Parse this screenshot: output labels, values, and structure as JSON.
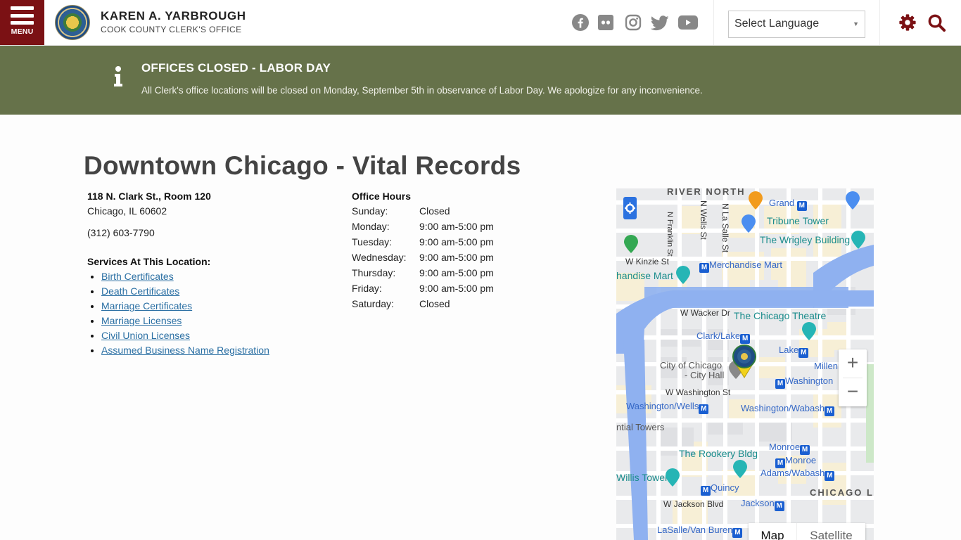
{
  "header": {
    "menu_label": "MENU",
    "brand_name": "KAREN A. YARBROUGH",
    "brand_subtitle": "COOK COUNTY CLERK'S OFFICE",
    "social_icons": [
      "facebook-icon",
      "flickr-icon",
      "instagram-icon",
      "twitter-icon",
      "youtube-icon"
    ],
    "language_select": {
      "selected": "Select Language"
    },
    "colors": {
      "brand": "#7b1114",
      "social": "#888888"
    }
  },
  "alert": {
    "title": "OFFICES CLOSED - LABOR DAY",
    "body": "All Clerk's office locations will be closed on Monday, September 5th in observance of Labor Day. We apologize for any inconvenience.",
    "color": "#66724a"
  },
  "main": {
    "title": "Downtown Chicago - Vital Records",
    "address_line1": "118 N. Clark St., Room 120",
    "address_line2": "Chicago, IL 60602",
    "phone": "(312) 603-7790",
    "services_title": "Services At This Location:",
    "services": [
      "Birth Certificates",
      "Death Certificates",
      "Marriage Certificates",
      "Marriage Licenses",
      "Civil Union Licenses",
      "Assumed Business Name Registration"
    ],
    "hours_title": "Office Hours",
    "hours": [
      {
        "day": "Sunday:",
        "time": "Closed"
      },
      {
        "day": "Monday:",
        "time": "9:00 am-5:00 pm"
      },
      {
        "day": "Tuesday:",
        "time": "9:00 am-5:00 pm"
      },
      {
        "day": "Wednesday:",
        "time": "9:00 am-5:00 pm"
      },
      {
        "day": "Thursday:",
        "time": "9:00 am-5:00 pm"
      },
      {
        "day": "Friday:",
        "time": "9:00 am-5:00 pm"
      },
      {
        "day": "Saturday:",
        "time": "Closed"
      }
    ]
  },
  "map": {
    "labels": {
      "river_north": "RIVER NORTH",
      "n_franklin": "N Franklin St",
      "n_wells": "N Wells St",
      "n_lasalle": "N La Salle St",
      "grand": "Grand",
      "tribune": "Tribune Tower",
      "wrigley": "The Wrigley Building",
      "w_kinzie": "W Kinzie St",
      "merch_mart_station": "Merchandise Mart",
      "merch_mart": "handise Mart",
      "w_wacker": "W Wacker Dr",
      "chicago_theatre": "The Chicago Theatre",
      "clark_lake": "Clark/Lake",
      "lake": "Lake",
      "city_hall_1": "City of Chicago",
      "city_hall_2": "- City Hall",
      "millennium": "Millenni",
      "washington": "Washington",
      "w_washington": "W Washington St",
      "washington_wells": "Washington/Wells",
      "washington_wabash": "Washington/Wabash",
      "towers": "ntial Towers",
      "monroe1": "Monroe",
      "monroe2": "Monroe",
      "rookery": "The Rookery Bldg",
      "adams_wabash": "Adams/Wabash",
      "willis": "Willis Tower",
      "quincy": "Quincy",
      "chicago_loop": "CHICAGO LO",
      "w_jackson": "W Jackson Blvd",
      "jackson": "Jackson",
      "lasalle_vanburen": "LaSalle/Van Buren",
      "metro_glyph": "M"
    },
    "zoom_in": "+",
    "zoom_out": "−",
    "map_type_map": "Map",
    "map_type_satellite": "Satellite"
  }
}
